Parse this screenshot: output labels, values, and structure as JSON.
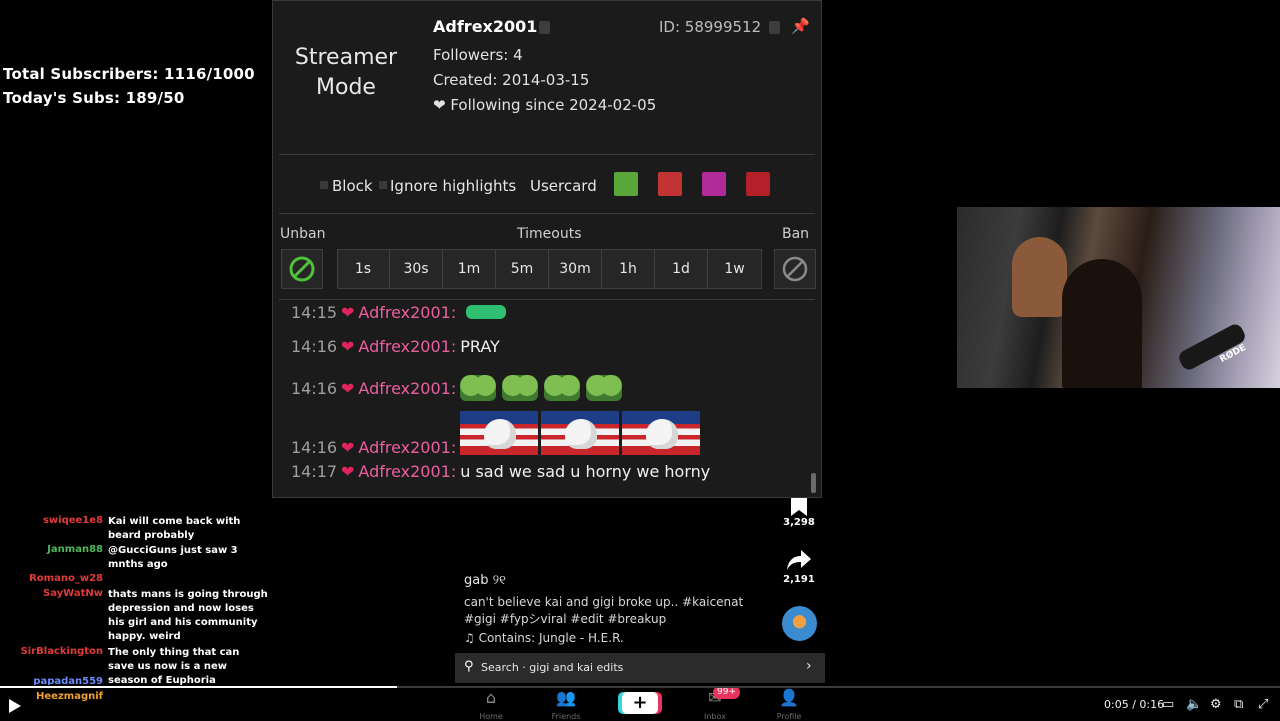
{
  "overlay": {
    "total_subs": "Total Subscribers: 1116/1000",
    "today_subs": "Today's Subs: 189/50"
  },
  "usercard": {
    "mode": "Streamer Mode",
    "username": "Adfrex2001",
    "user_id": "ID: 58999512",
    "followers": "Followers: 4",
    "created": "Created: 2014-03-15",
    "following": "❤ Following since 2024-02-05",
    "options": {
      "block": "Block",
      "ignore": "Ignore highlights",
      "usercard": "Usercard"
    },
    "mod": {
      "unban_label": "Unban",
      "timeouts_label": "Timeouts",
      "ban_label": "Ban",
      "timeouts": [
        "1s",
        "30s",
        "1m",
        "5m",
        "30m",
        "1h",
        "1d",
        "1w"
      ]
    },
    "chat": [
      {
        "time": "14:15",
        "user": "Adfrex2001:",
        "msg": ""
      },
      {
        "time": "14:16",
        "user": "Adfrex2001:",
        "msg": "PRAY"
      },
      {
        "time": "14:16",
        "user": "Adfrex2001:",
        "msg": ""
      },
      {
        "time": "14:16",
        "user": "Adfrex2001:",
        "msg": ""
      },
      {
        "time": "14:17",
        "user": "Adfrex2001:",
        "msg": "u sad we sad u horny we horny"
      }
    ]
  },
  "webcam": {
    "mic_brand": "RØDE"
  },
  "stream_chat": [
    {
      "user": "swiqee1e8",
      "color": "#e03a3a",
      "msg": "Kai will come back with beard probably"
    },
    {
      "user": "Janman88",
      "color": "#4fb85a",
      "msg": "@GucciGuns just saw 3 mnths ago"
    },
    {
      "user": "Romano_w28",
      "color": "#e03a3a",
      "msg": ""
    },
    {
      "user": "SayWatNw",
      "color": "#e03a3a",
      "msg": "thats mans is going through depression and now loses his girl and his community happy. weird"
    },
    {
      "user": "SirBlackington",
      "color": "#e03a3a",
      "msg": "The only thing that can save us now is a new season of Euphoria"
    },
    {
      "user": "papadan559",
      "color": "#6c8cff",
      "msg": ""
    },
    {
      "user": "Heezmagnif",
      "color": "#f0a030",
      "msg": ""
    }
  ],
  "tiktok": {
    "saves": "3,298",
    "shares": "2,191",
    "author": "gab ୨୧",
    "caption_1": "can't believe kai and gigi broke up.. #kaicenat",
    "caption_2": "#gigi #fypシviral #edit #breakup",
    "sound": "♫ Contains: Jungle - H.E.R.",
    "search": "Search · gigi and kai edits",
    "nav": [
      "Home",
      "Friends",
      "",
      "Inbox",
      "Profile"
    ],
    "inbox_badge": "99+"
  },
  "player": {
    "time": "0:05 / 0:16"
  }
}
